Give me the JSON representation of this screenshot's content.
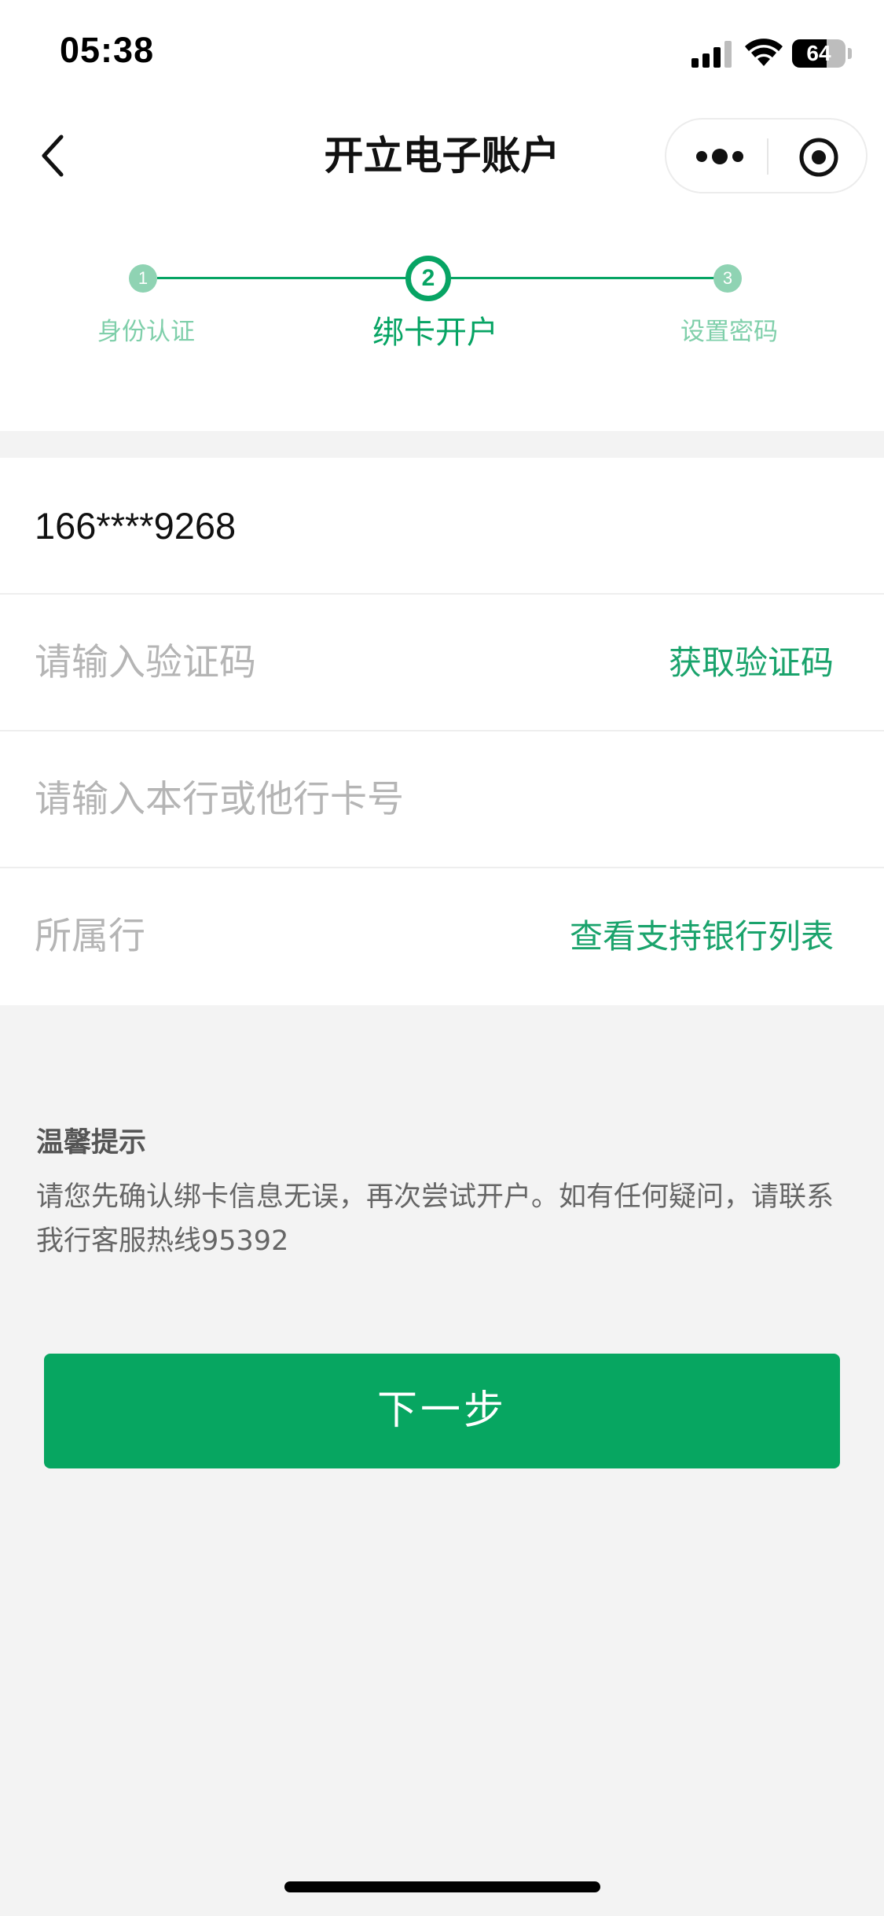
{
  "status_bar": {
    "time": "05:38",
    "battery_level": "64"
  },
  "nav": {
    "title": "开立电子账户",
    "back_icon": "chevron-left-icon",
    "more_icon": "more-dots-icon",
    "close_icon": "target-circle-icon"
  },
  "stepper": {
    "steps": [
      {
        "number": "1",
        "label": "身份认证",
        "state": "done"
      },
      {
        "number": "2",
        "label": "绑卡开户",
        "state": "active"
      },
      {
        "number": "3",
        "label": "设置密码",
        "state": "pending"
      }
    ],
    "accent_color": "#07a464"
  },
  "form": {
    "phone_value": "166****9268",
    "code_placeholder": "请输入验证码",
    "get_code_label": "获取验证码",
    "card_placeholder": "请输入本行或他行卡号",
    "bank_placeholder": "所属行",
    "bank_list_link": "查看支持银行列表"
  },
  "tips": {
    "title": "温馨提示",
    "body": "请您先确认绑卡信息无误，再次尝试开户。如有任何疑问，请联系我行客服热线95392"
  },
  "next_button": {
    "label": "下一步",
    "color": "#07a661"
  }
}
